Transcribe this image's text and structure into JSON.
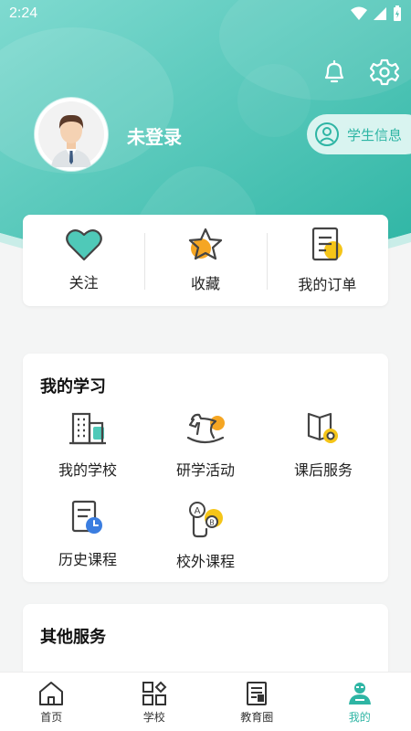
{
  "status_bar": {
    "time": "2:24",
    "icons": [
      "wifi-icon",
      "signal-icon",
      "battery-icon"
    ]
  },
  "header": {
    "login_status": "未登录",
    "student_info_label": "学生信息",
    "actions": [
      "bell-icon",
      "settings-icon"
    ]
  },
  "quick_actions": [
    {
      "label": "关注",
      "icon": "heart-icon"
    },
    {
      "label": "收藏",
      "icon": "star-icon"
    },
    {
      "label": "我的订单",
      "icon": "order-icon"
    }
  ],
  "study": {
    "title": "我的学习",
    "items": [
      {
        "label": "我的学校",
        "icon": "school-building-icon"
      },
      {
        "label": "研学活动",
        "icon": "rocking-horse-icon"
      },
      {
        "label": "课后服务",
        "icon": "book-gear-icon"
      },
      {
        "label": "历史课程",
        "icon": "document-clock-icon"
      },
      {
        "label": "校外课程",
        "icon": "route-ab-icon"
      }
    ]
  },
  "other_services": {
    "title": "其他服务"
  },
  "tabbar": {
    "tabs": [
      {
        "label": "首页",
        "icon": "home-icon"
      },
      {
        "label": "学校",
        "icon": "grid-icon"
      },
      {
        "label": "教育圈",
        "icon": "news-icon"
      },
      {
        "label": "我的",
        "icon": "profile-icon"
      }
    ],
    "active": "我的"
  },
  "colors": {
    "accent": "#2eb5a4",
    "accent_light": "#4fd0c0",
    "highlight": "#f5a623"
  }
}
